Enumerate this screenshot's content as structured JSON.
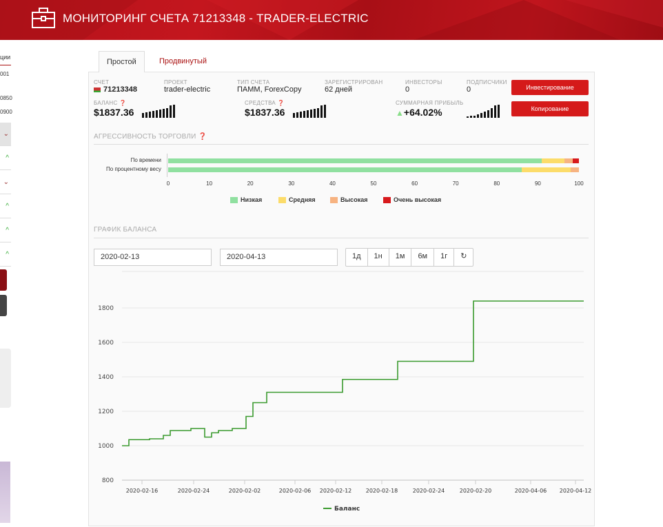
{
  "header": {
    "title": "МОНИТОРИНГ СЧЕТА 71213348 - TRADER-ELECTRIC",
    "icon": "briefcase-icon"
  },
  "sidebar": {
    "heading": "ции",
    "items": [
      "001",
      "0850",
      "0900"
    ]
  },
  "tabs": [
    {
      "label": "Простой",
      "active": true
    },
    {
      "label": "Продвинутый",
      "active": false
    }
  ],
  "account": {
    "account_label": "СЧЕТ",
    "account_number": "71213348",
    "project_label": "ПРОЕКТ",
    "project": "trader-electric",
    "type_label": "ТИП СЧЕТА",
    "type": "ПАММ, ForexCopy",
    "registered_label": "ЗАРЕГИСТРИРОВАН",
    "registered": "62 дней",
    "investors_label": "ИНВЕСТОРЫ",
    "investors": "0",
    "subscribers_label": "ПОДПИСЧИКИ",
    "subscribers": "0",
    "balance_label": "БАЛАНС",
    "balance": "$1837.36",
    "equity_label": "СРЕДСТВА",
    "equity": "$1837.36",
    "profit_label": "СУММАРНАЯ ПРИБЫЛЬ",
    "profit": "+64.02%",
    "invest_button": "Инвестирование",
    "copy_button": "Копирование"
  },
  "colors": {
    "accent": "#d51a1a",
    "low": "#90e0a0",
    "medium": "#fcdc6a",
    "high": "#f7b381",
    "very_high": "#d7191c",
    "line": "#3a9a2e"
  },
  "aggression": {
    "title": "АГРЕССИВНОСТЬ ТОРГОВЛИ",
    "rows": [
      {
        "label": "По времени",
        "values": [
          91,
          5.5,
          2,
          1.5
        ]
      },
      {
        "label": "По процентному весу",
        "values": [
          86,
          12,
          2,
          0
        ]
      }
    ],
    "ticks": [
      "0",
      "10",
      "20",
      "30",
      "40",
      "50",
      "60",
      "70",
      "80",
      "90",
      "100"
    ],
    "legend": [
      "Низкая",
      "Средняя",
      "Высокая",
      "Очень высокая"
    ]
  },
  "balance_chart": {
    "title": "ГРАФИК БАЛАНСА",
    "date_from": "2020-02-13",
    "date_to": "2020-04-13",
    "ranges": [
      "1д",
      "1н",
      "1м",
      "6м",
      "1г"
    ]
  },
  "chart_data": {
    "type": "line",
    "series": [
      {
        "name": "Баланс",
        "values": [
          1000,
          1035,
          1035,
          1035,
          1040,
          1040,
          1060,
          1088,
          1088,
          1088,
          1100,
          1100,
          1050,
          1075,
          1088,
          1088,
          1100,
          1100,
          1170,
          1250,
          1250,
          1310,
          1310,
          1310,
          1310,
          1310,
          1310,
          1310,
          1310,
          1310,
          1310,
          1310,
          1385,
          1385,
          1385,
          1385,
          1385,
          1385,
          1385,
          1385,
          1490,
          1490,
          1490,
          1490,
          1490,
          1490,
          1490,
          1490,
          1490,
          1490,
          1490,
          1840,
          1840,
          1840,
          1840,
          1840,
          1840,
          1840,
          1840,
          1840,
          1840,
          1840,
          1840,
          1840,
          1840,
          1840,
          1840,
          1840
        ]
      }
    ],
    "x_tick_labels": [
      "2020-02-16",
      "2020-02-24",
      "2020-02-02",
      "2020-02-06",
      "2020-02-12",
      "2020-02-18",
      "2020-02-24",
      "2020-02-20",
      "2020-04-06",
      "2020-04-12"
    ],
    "y_ticks": [
      800,
      1000,
      1200,
      1400,
      1600,
      1800
    ],
    "ylim": [
      800,
      1900
    ],
    "grid": true,
    "legend": "bottom"
  }
}
